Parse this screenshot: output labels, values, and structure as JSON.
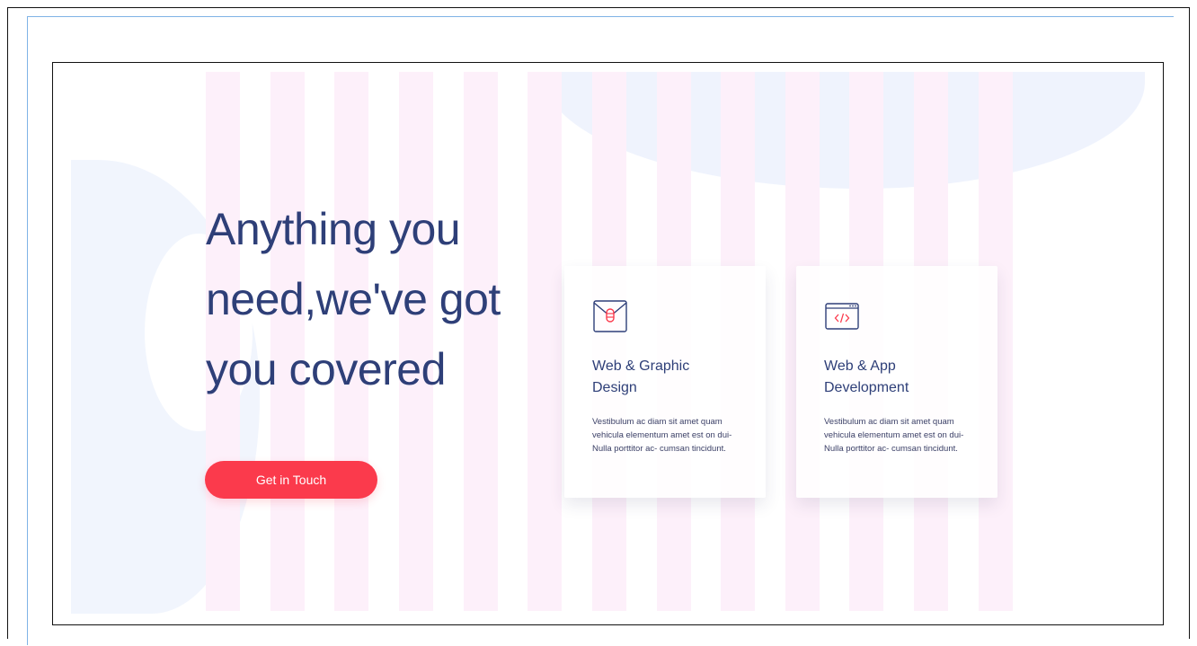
{
  "hero": {
    "headline_lines": [
      "Anything you",
      "need,we've got",
      "you covered"
    ],
    "cta_label": "Get in Touch"
  },
  "cards": [
    {
      "title_lines": [
        "Web & Graphic",
        "Design"
      ],
      "description": "Vestibulum ac diam sit amet quam vehicula elementum amet est on dui- Nulla porttitor ac- cumsan tincidunt.",
      "icon": "envelope-icon"
    },
    {
      "title_lines": [
        "Web & App",
        "Development"
      ],
      "description": "Vestibulum ac diam sit amet quam vehicula elementum amet est on dui- Nulla porttitor ac- cumsan tincidunt.",
      "icon": "code-window-icon"
    }
  ],
  "colors": {
    "heading": "#2e3f78",
    "accent": "#fb3a4c",
    "stripe": "#fdf0fa",
    "blob": "#f1f5fd"
  }
}
